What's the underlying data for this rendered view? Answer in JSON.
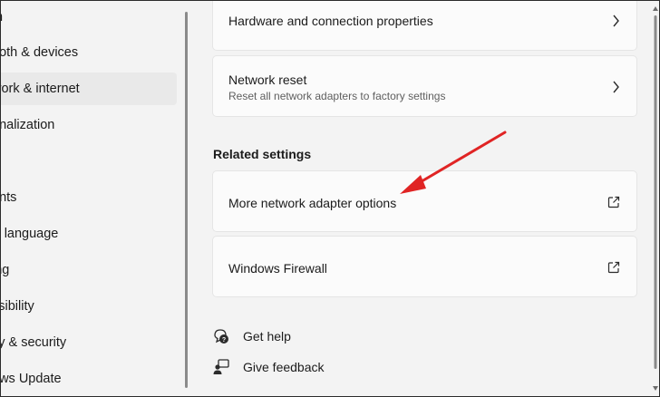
{
  "sidebar": {
    "items": [
      {
        "label": "m"
      },
      {
        "label": "ooth & devices"
      },
      {
        "label": "work & internet"
      },
      {
        "label": "onalization"
      },
      {
        "label": ""
      },
      {
        "label": "unts"
      },
      {
        "label": " & language"
      },
      {
        "label": "ing"
      },
      {
        "label": "ssibility"
      },
      {
        "label": "cy & security"
      },
      {
        "label": "ows Update"
      }
    ],
    "selected_index": 2
  },
  "cards": {
    "hardware": {
      "title": "Hardware and connection properties",
      "icon": "chevron-right-icon"
    },
    "reset": {
      "title": "Network reset",
      "subtitle": "Reset all network adapters to factory settings",
      "icon": "chevron-right-icon"
    }
  },
  "related_settings": {
    "heading": "Related settings",
    "adapter": {
      "title": "More network adapter options",
      "icon": "open-external-icon"
    },
    "firewall": {
      "title": "Windows Firewall",
      "icon": "open-external-icon"
    }
  },
  "help": {
    "get_help": "Get help",
    "give_feedback": "Give feedback"
  },
  "colors": {
    "background": "#f3f3f3",
    "card": "#fbfbfb",
    "selected_nav": "#e9e9e9",
    "annotation_arrow": "#e02424"
  }
}
